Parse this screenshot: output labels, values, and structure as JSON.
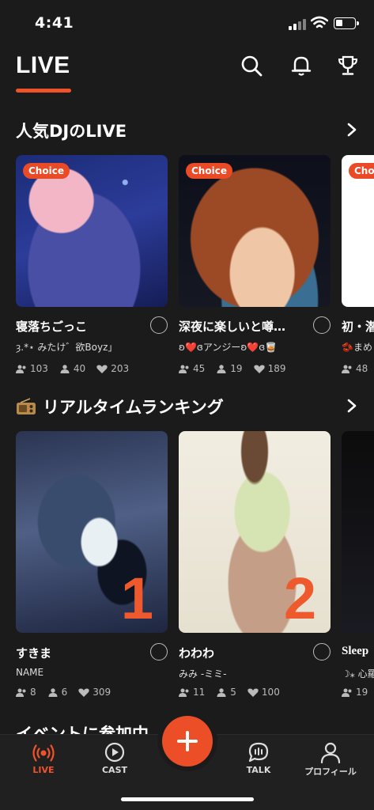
{
  "status_bar": {
    "time": "4:41"
  },
  "header": {
    "title": "LIVE",
    "accent": "#f0532a"
  },
  "popular": {
    "heading": "人気DJのLIVE",
    "cards": [
      {
        "badge": "Choice",
        "title": "寝落ちごっこ",
        "dj": "ȝ.*⋆ みたけ゛欲Boyz」",
        "listeners": "103",
        "members": "40",
        "likes": "203"
      },
      {
        "badge": "Choice",
        "title": "深夜に楽しいと噂…",
        "dj": "ʚ❤️ɞアンジーʚ❤️ɞ🥃",
        "listeners": "45",
        "members": "19",
        "likes": "189"
      },
      {
        "badge": "Choice",
        "title": "初・潜",
        "dj": "🫘まめ",
        "listeners": "48"
      }
    ]
  },
  "ranking": {
    "heading": "リアルタイムランキング",
    "cards": [
      {
        "rank": "1",
        "title": "すきま",
        "dj": "NAME",
        "listeners": "8",
        "members": "6",
        "likes": "309"
      },
      {
        "rank": "2",
        "title": "わわわ",
        "dj": "みみ -ミミ-",
        "listeners": "11",
        "members": "5",
        "likes": "100"
      },
      {
        "title": "Sleep",
        "dj": "☽⁎ 心羅",
        "listeners": "19"
      }
    ]
  },
  "next_section": {
    "heading": "イベントに参加中"
  },
  "nav": {
    "tabs": [
      {
        "label": "LIVE",
        "icon": "broadcast-icon",
        "active": true
      },
      {
        "label": "CAST",
        "icon": "play-circle-icon"
      },
      {
        "label": "",
        "icon": "plus-icon"
      },
      {
        "label": "TALK",
        "icon": "talk-bubble-icon"
      },
      {
        "label": "プロフィール",
        "icon": "person-icon"
      }
    ]
  },
  "colors": {
    "accent": "#ea4a25",
    "background": "#1b1b1b"
  }
}
